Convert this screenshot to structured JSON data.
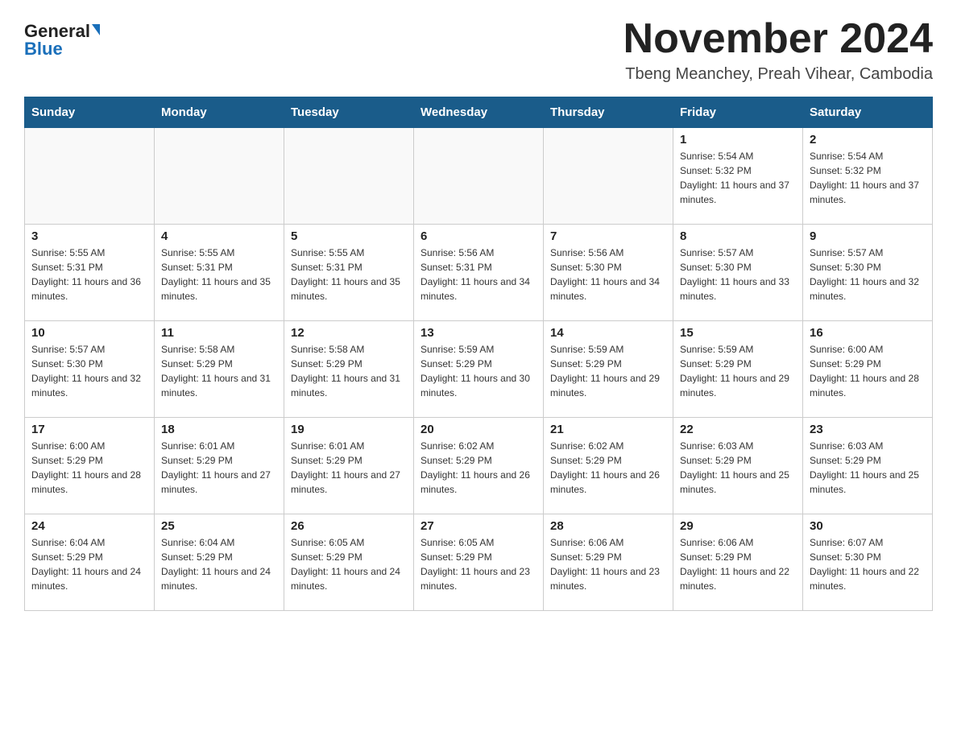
{
  "logo": {
    "general": "General",
    "blue": "Blue"
  },
  "title": "November 2024",
  "subtitle": "Tbeng Meanchey, Preah Vihear, Cambodia",
  "weekdays": [
    "Sunday",
    "Monday",
    "Tuesday",
    "Wednesday",
    "Thursday",
    "Friday",
    "Saturday"
  ],
  "weeks": [
    [
      {
        "day": "",
        "sunrise": "",
        "sunset": "",
        "daylight": ""
      },
      {
        "day": "",
        "sunrise": "",
        "sunset": "",
        "daylight": ""
      },
      {
        "day": "",
        "sunrise": "",
        "sunset": "",
        "daylight": ""
      },
      {
        "day": "",
        "sunrise": "",
        "sunset": "",
        "daylight": ""
      },
      {
        "day": "",
        "sunrise": "",
        "sunset": "",
        "daylight": ""
      },
      {
        "day": "1",
        "sunrise": "Sunrise: 5:54 AM",
        "sunset": "Sunset: 5:32 PM",
        "daylight": "Daylight: 11 hours and 37 minutes."
      },
      {
        "day": "2",
        "sunrise": "Sunrise: 5:54 AM",
        "sunset": "Sunset: 5:32 PM",
        "daylight": "Daylight: 11 hours and 37 minutes."
      }
    ],
    [
      {
        "day": "3",
        "sunrise": "Sunrise: 5:55 AM",
        "sunset": "Sunset: 5:31 PM",
        "daylight": "Daylight: 11 hours and 36 minutes."
      },
      {
        "day": "4",
        "sunrise": "Sunrise: 5:55 AM",
        "sunset": "Sunset: 5:31 PM",
        "daylight": "Daylight: 11 hours and 35 minutes."
      },
      {
        "day": "5",
        "sunrise": "Sunrise: 5:55 AM",
        "sunset": "Sunset: 5:31 PM",
        "daylight": "Daylight: 11 hours and 35 minutes."
      },
      {
        "day": "6",
        "sunrise": "Sunrise: 5:56 AM",
        "sunset": "Sunset: 5:31 PM",
        "daylight": "Daylight: 11 hours and 34 minutes."
      },
      {
        "day": "7",
        "sunrise": "Sunrise: 5:56 AM",
        "sunset": "Sunset: 5:30 PM",
        "daylight": "Daylight: 11 hours and 34 minutes."
      },
      {
        "day": "8",
        "sunrise": "Sunrise: 5:57 AM",
        "sunset": "Sunset: 5:30 PM",
        "daylight": "Daylight: 11 hours and 33 minutes."
      },
      {
        "day": "9",
        "sunrise": "Sunrise: 5:57 AM",
        "sunset": "Sunset: 5:30 PM",
        "daylight": "Daylight: 11 hours and 32 minutes."
      }
    ],
    [
      {
        "day": "10",
        "sunrise": "Sunrise: 5:57 AM",
        "sunset": "Sunset: 5:30 PM",
        "daylight": "Daylight: 11 hours and 32 minutes."
      },
      {
        "day": "11",
        "sunrise": "Sunrise: 5:58 AM",
        "sunset": "Sunset: 5:29 PM",
        "daylight": "Daylight: 11 hours and 31 minutes."
      },
      {
        "day": "12",
        "sunrise": "Sunrise: 5:58 AM",
        "sunset": "Sunset: 5:29 PM",
        "daylight": "Daylight: 11 hours and 31 minutes."
      },
      {
        "day": "13",
        "sunrise": "Sunrise: 5:59 AM",
        "sunset": "Sunset: 5:29 PM",
        "daylight": "Daylight: 11 hours and 30 minutes."
      },
      {
        "day": "14",
        "sunrise": "Sunrise: 5:59 AM",
        "sunset": "Sunset: 5:29 PM",
        "daylight": "Daylight: 11 hours and 29 minutes."
      },
      {
        "day": "15",
        "sunrise": "Sunrise: 5:59 AM",
        "sunset": "Sunset: 5:29 PM",
        "daylight": "Daylight: 11 hours and 29 minutes."
      },
      {
        "day": "16",
        "sunrise": "Sunrise: 6:00 AM",
        "sunset": "Sunset: 5:29 PM",
        "daylight": "Daylight: 11 hours and 28 minutes."
      }
    ],
    [
      {
        "day": "17",
        "sunrise": "Sunrise: 6:00 AM",
        "sunset": "Sunset: 5:29 PM",
        "daylight": "Daylight: 11 hours and 28 minutes."
      },
      {
        "day": "18",
        "sunrise": "Sunrise: 6:01 AM",
        "sunset": "Sunset: 5:29 PM",
        "daylight": "Daylight: 11 hours and 27 minutes."
      },
      {
        "day": "19",
        "sunrise": "Sunrise: 6:01 AM",
        "sunset": "Sunset: 5:29 PM",
        "daylight": "Daylight: 11 hours and 27 minutes."
      },
      {
        "day": "20",
        "sunrise": "Sunrise: 6:02 AM",
        "sunset": "Sunset: 5:29 PM",
        "daylight": "Daylight: 11 hours and 26 minutes."
      },
      {
        "day": "21",
        "sunrise": "Sunrise: 6:02 AM",
        "sunset": "Sunset: 5:29 PM",
        "daylight": "Daylight: 11 hours and 26 minutes."
      },
      {
        "day": "22",
        "sunrise": "Sunrise: 6:03 AM",
        "sunset": "Sunset: 5:29 PM",
        "daylight": "Daylight: 11 hours and 25 minutes."
      },
      {
        "day": "23",
        "sunrise": "Sunrise: 6:03 AM",
        "sunset": "Sunset: 5:29 PM",
        "daylight": "Daylight: 11 hours and 25 minutes."
      }
    ],
    [
      {
        "day": "24",
        "sunrise": "Sunrise: 6:04 AM",
        "sunset": "Sunset: 5:29 PM",
        "daylight": "Daylight: 11 hours and 24 minutes."
      },
      {
        "day": "25",
        "sunrise": "Sunrise: 6:04 AM",
        "sunset": "Sunset: 5:29 PM",
        "daylight": "Daylight: 11 hours and 24 minutes."
      },
      {
        "day": "26",
        "sunrise": "Sunrise: 6:05 AM",
        "sunset": "Sunset: 5:29 PM",
        "daylight": "Daylight: 11 hours and 24 minutes."
      },
      {
        "day": "27",
        "sunrise": "Sunrise: 6:05 AM",
        "sunset": "Sunset: 5:29 PM",
        "daylight": "Daylight: 11 hours and 23 minutes."
      },
      {
        "day": "28",
        "sunrise": "Sunrise: 6:06 AM",
        "sunset": "Sunset: 5:29 PM",
        "daylight": "Daylight: 11 hours and 23 minutes."
      },
      {
        "day": "29",
        "sunrise": "Sunrise: 6:06 AM",
        "sunset": "Sunset: 5:29 PM",
        "daylight": "Daylight: 11 hours and 22 minutes."
      },
      {
        "day": "30",
        "sunrise": "Sunrise: 6:07 AM",
        "sunset": "Sunset: 5:30 PM",
        "daylight": "Daylight: 11 hours and 22 minutes."
      }
    ]
  ]
}
